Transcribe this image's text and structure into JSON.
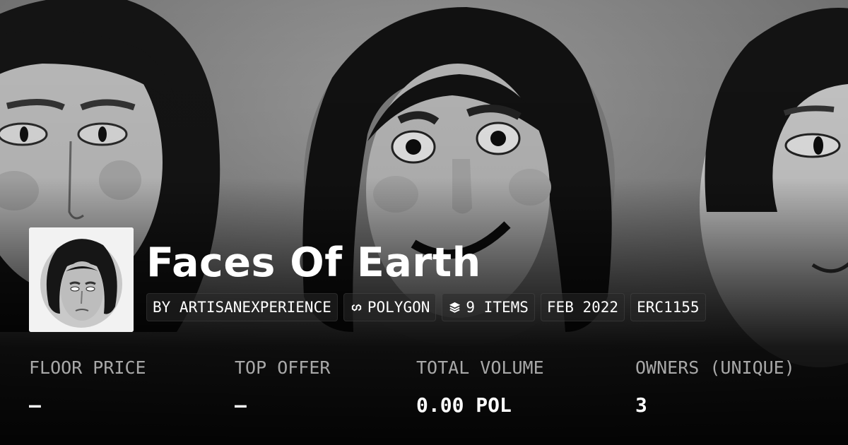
{
  "collection": {
    "title": "Faces Of Earth",
    "chips": [
      {
        "label": "BY ARTISANEXPERIENCE"
      },
      {
        "icon": "polygon-chain-icon",
        "label": "POLYGON"
      },
      {
        "icon": "layers-icon",
        "label": "9 ITEMS"
      },
      {
        "label": "FEB 2022"
      },
      {
        "label": "ERC1155"
      }
    ]
  },
  "stats": [
    {
      "label": "FLOOR PRICE",
      "value": "—"
    },
    {
      "label": "TOP OFFER",
      "value": "—"
    },
    {
      "label": "TOTAL VOLUME",
      "value": "0.00 POL"
    },
    {
      "label": "OWNERS (UNIQUE)",
      "value": "3"
    }
  ]
}
